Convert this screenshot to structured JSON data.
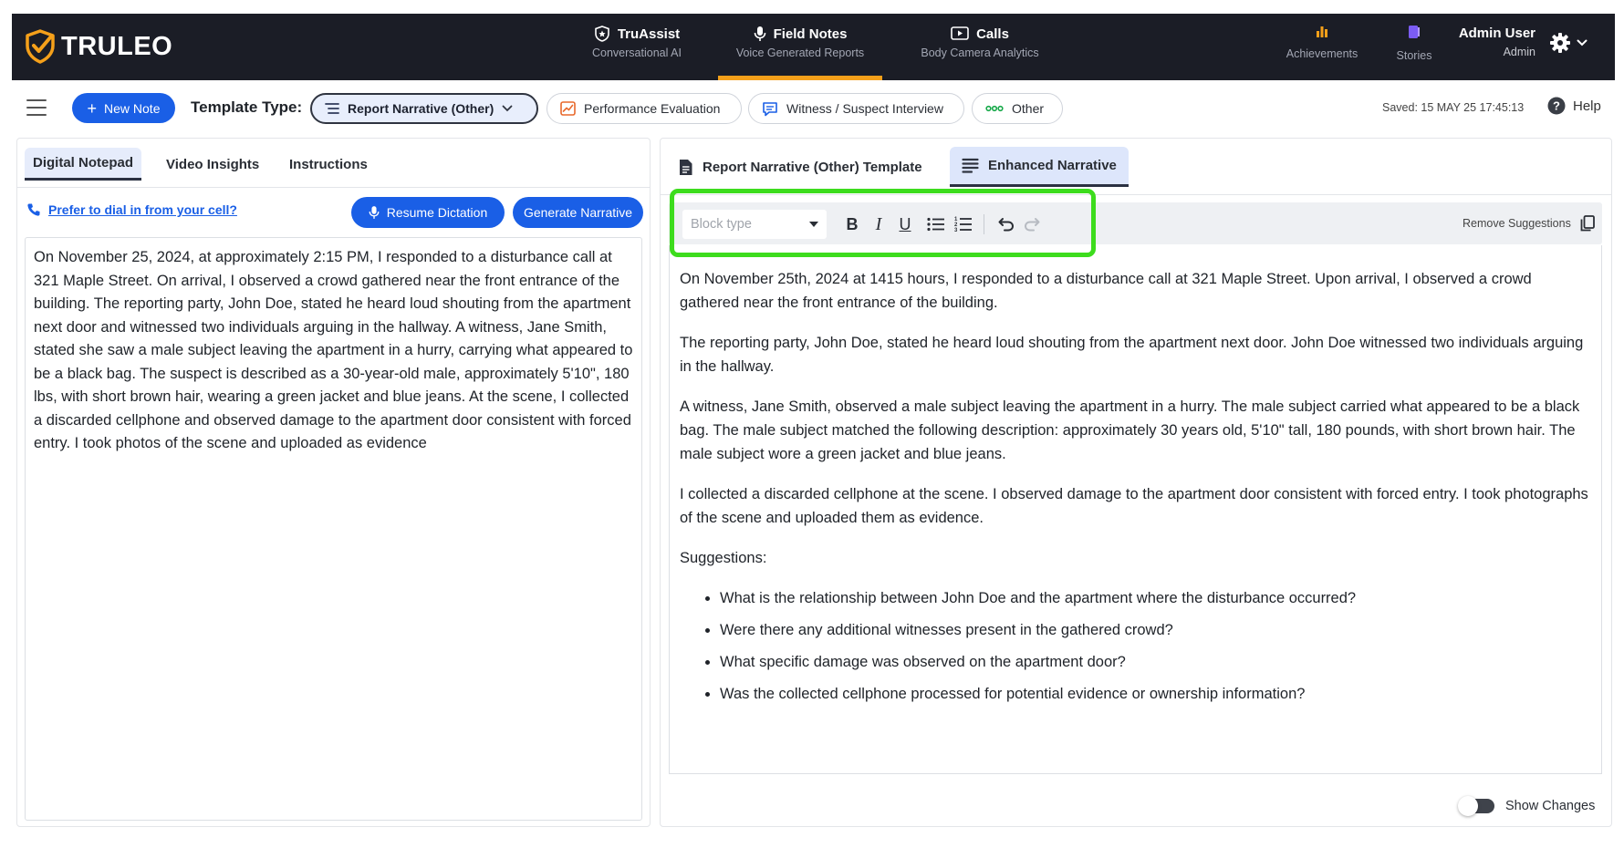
{
  "brand": {
    "name": "TRULEO",
    "accent": "#f5a01a"
  },
  "nav": {
    "items": [
      {
        "title": "TruAssist",
        "subtitle": "Conversational AI",
        "icon": "shield-star-icon"
      },
      {
        "title": "Field Notes",
        "subtitle": "Voice Generated Reports",
        "icon": "microphone-icon",
        "active": true
      },
      {
        "title": "Calls",
        "subtitle": "Body Camera Analytics",
        "icon": "play-screen-icon"
      }
    ],
    "achievements": "Achievements",
    "stories": "Stories",
    "user_name": "Admin User",
    "user_role": "Admin"
  },
  "toolbar": {
    "new_note": "New Note",
    "template_label": "Template Type:",
    "templates": [
      {
        "label": "Report Narrative (Other)",
        "selected": true
      },
      {
        "label": "Performance Evaluation"
      },
      {
        "label": "Witness / Suspect Interview"
      },
      {
        "label": "Other"
      }
    ],
    "saved": "Saved: 15 MAY 25 17:45:13",
    "help": "Help"
  },
  "left": {
    "tabs": [
      "Digital Notepad",
      "Video Insights",
      "Instructions"
    ],
    "dial_link": "Prefer to dial in from your cell?",
    "resume_dictation": "Resume Dictation",
    "generate_narrative": "Generate Narrative",
    "notes": "On November 25, 2024, at approximately 2:15 PM, I responded to a disturbance call at 321 Maple Street. On arrival, I observed a crowd gathered near the front entrance of the building. The reporting party, John Doe, stated he heard loud shouting from the apartment next door and witnessed two individuals arguing in the hallway. A witness, Jane Smith, stated she saw a male subject leaving the apartment in a hurry, carrying what appeared to be a black bag. The suspect is described as a 30-year-old male, approximately 5'10\", 180 lbs, with short brown hair, wearing a green jacket and blue jeans. At the scene, I collected a discarded cellphone and observed damage to the apartment door consistent with forced entry. I took photos of the scene and uploaded as evidence"
  },
  "right": {
    "tabs": [
      "Report Narrative (Other) Template",
      "Enhanced Narrative"
    ],
    "block_type_placeholder": "Block type",
    "remove_suggestions": "Remove Suggestions",
    "paragraphs": [
      "On November 25th, 2024 at 1415 hours, I responded to a disturbance call at 321 Maple Street. Upon arrival, I observed a crowd gathered near the front entrance of the building.",
      "The reporting party, John Doe, stated he heard loud shouting from the apartment next door. John Doe witnessed two individuals arguing in the hallway.",
      "A witness, Jane Smith, observed a male subject leaving the apartment in a hurry. The male subject carried what appeared to be a black bag. The male subject matched the following description: approximately 30 years old, 5'10\" tall, 180 pounds, with short brown hair. The male subject wore a green jacket and blue jeans.",
      "I collected a discarded cellphone at the scene. I observed damage to the apartment door consistent with forced entry. I took photographs of the scene and uploaded them as evidence."
    ],
    "suggestions_heading": "Suggestions:",
    "suggestions": [
      "What is the relationship between John Doe and the apartment where the disturbance occurred?",
      "Were there any additional witnesses present in the gathered crowd?",
      "What specific damage was observed on the apartment door?",
      "Was the collected cellphone processed for potential evidence or ownership information?"
    ],
    "show_changes": "Show Changes"
  },
  "colors": {
    "primary": "#1a5fe6",
    "highlight": "#3ddc1d",
    "topbar": "#1b1d26"
  }
}
